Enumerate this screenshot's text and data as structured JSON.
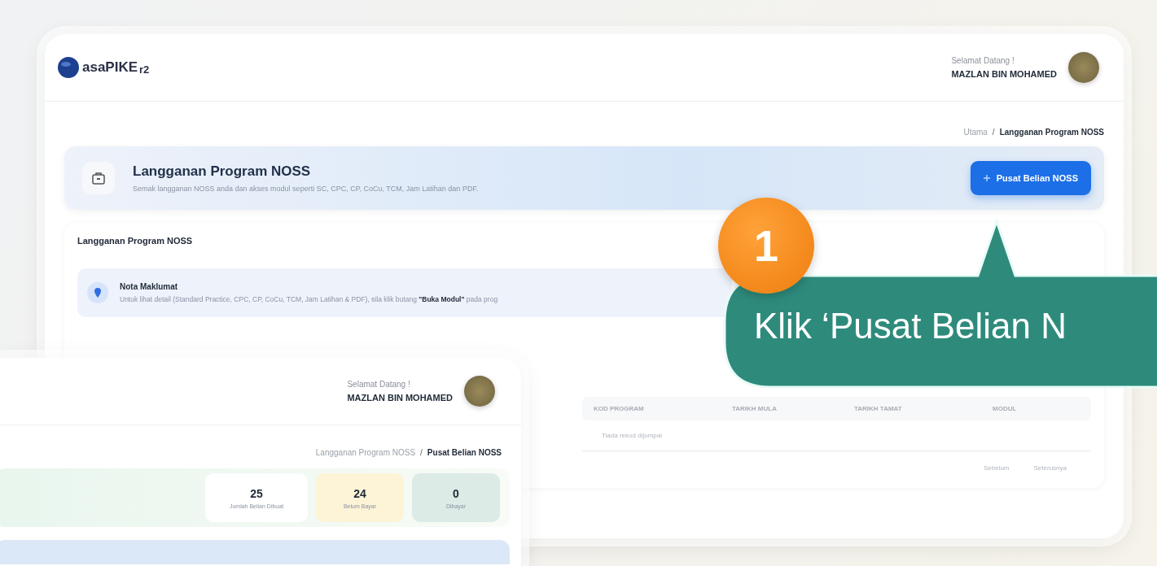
{
  "main_window": {
    "logo": {
      "text": "asaPIKE",
      "suffix": "r2"
    },
    "user": {
      "greeting": "Selamat Datang !",
      "name": "MAZLAN BIN MOHAMED"
    },
    "breadcrumb_separator": "/",
    "breadcrumb": [
      {
        "label": "Utama",
        "current": false
      },
      {
        "label": "Langganan Program NOSS",
        "current": true
      }
    ],
    "banner": {
      "title": "Langganan Program NOSS",
      "subtitle": "Semak langganan NOSS anda dan akses modul seperti SC, CPC, CP, CoCu, TCM, Jam Latihan dan PDF.",
      "button": "Pusat Belian NOSS"
    },
    "section": {
      "title": "Langganan Program NOSS",
      "notice": {
        "title": "Nota Maklumat",
        "text": "Untuk lihat detail (Standard Practice, CPC, CP, CoCu, TCM, Jam Latihan & PDF), sila klik butang **\"Buka Modul\"** pada prog"
      },
      "table": {
        "columns": [
          "KOD PROGRAM",
          "TARIKH MULA",
          "TARIKH TAMAT",
          "MODUL"
        ],
        "empty_text": "Tiada rekod dijumpai"
      },
      "pagination": [
        "Sebelum",
        "Seterusnya"
      ]
    }
  },
  "second_window": {
    "user": {
      "greeting": "Selamat Datang !",
      "name": "MAZLAN BIN MOHAMED"
    },
    "breadcrumb_separator": "/",
    "breadcrumb": [
      {
        "label": "Langganan Program NOSS",
        "current": false
      },
      {
        "label": "Pusat Belian NOSS",
        "current": true
      }
    ],
    "stats": [
      {
        "value": "25",
        "label": "Jumlah Belian Dibuat",
        "color": "#ffffff"
      },
      {
        "value": "24",
        "label": "Belum Bayar",
        "color": "#fdf3d6"
      },
      {
        "value": "0",
        "label": "Dibayar",
        "color": "#dcebe6"
      }
    ]
  },
  "callout": {
    "step": "1",
    "text": "Klik ‘Pusat Belian N"
  }
}
